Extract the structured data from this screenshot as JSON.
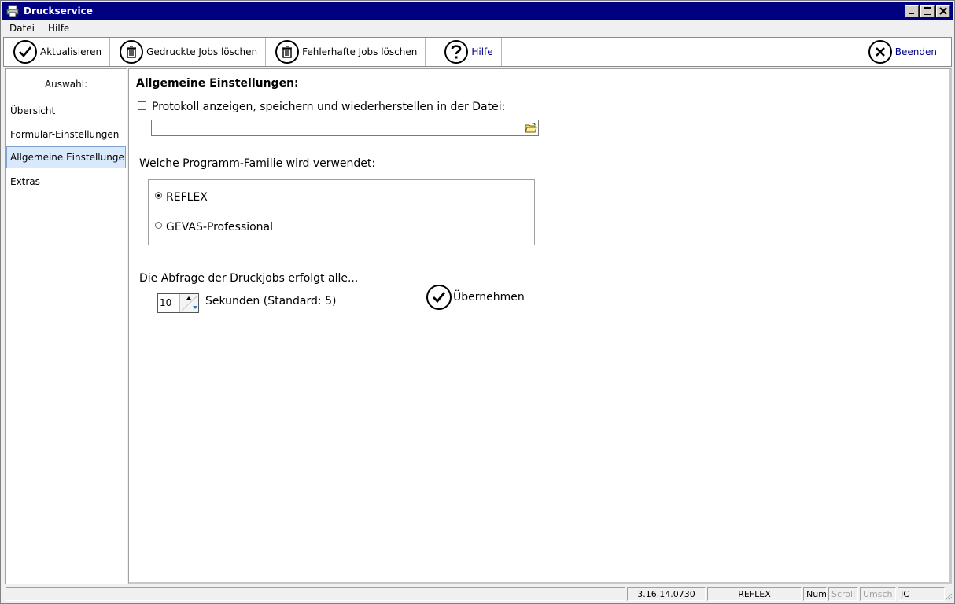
{
  "window": {
    "title": "Druckservice",
    "title_bar_color": "#000080"
  },
  "menubar": {
    "items": [
      {
        "label": "Datei"
      },
      {
        "label": "Hilfe"
      }
    ]
  },
  "toolbar": {
    "refresh_label": "Aktualisieren",
    "delete_printed_label": "Gedruckte Jobs löschen",
    "delete_failed_label": "Fehlerhafte Jobs löschen",
    "help_label": "Hilfe",
    "exit_label": "Beenden",
    "link_color": "#00008b"
  },
  "sidebar": {
    "heading": "Auswahl:",
    "items": [
      {
        "label": "Übersicht",
        "active": false
      },
      {
        "label": "Formular-Einstellungen",
        "active": false
      },
      {
        "label": "Allgemeine Einstellungen",
        "active": true
      },
      {
        "label": "Extras",
        "active": false
      }
    ]
  },
  "main": {
    "title": "Allgemeine Einstellungen:",
    "log_checkbox_label": "Protokoll anzeigen, speichern und wiederherstellen in der Datei:",
    "log_checkbox_checked": false,
    "log_file_value": "",
    "family_question": "Welche Programm-Familie wird verwendet:",
    "family_options": [
      {
        "label": "REFLEX",
        "checked": true
      },
      {
        "label": "GEVAS-Professional",
        "checked": false
      }
    ],
    "poll_label": "Die Abfrage der Druckjobs erfolgt alle...",
    "poll_value": "10",
    "poll_unit_label": "Sekunden (Standard: 5)",
    "apply_label": "Übernehmen"
  },
  "statusbar": {
    "version": "3.16.14.0730",
    "family": "REFLEX",
    "num": "Num",
    "scroll": "Scroll",
    "shift": "Umsch",
    "user": "JC"
  }
}
